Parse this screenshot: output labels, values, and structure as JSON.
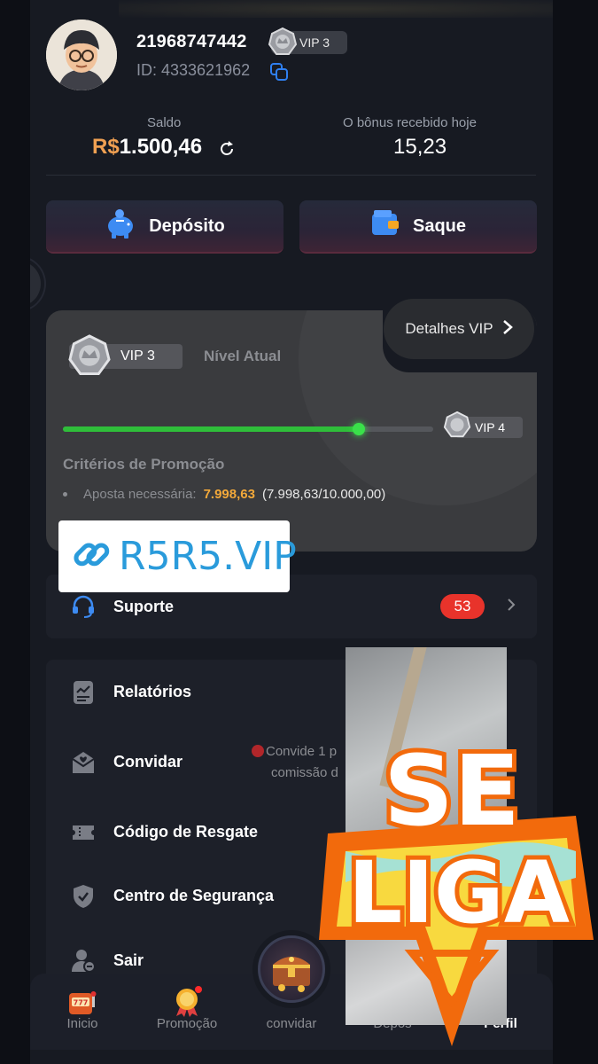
{
  "profile": {
    "username": "21968747442",
    "vip_chip": "VIP 3",
    "user_id": "ID: 4333621962"
  },
  "balance": {
    "saldo_label": "Saldo",
    "currency": "R$",
    "amount": "1.500,46",
    "bonus_label": "O bônus recebido hoje",
    "bonus_value": "15,23"
  },
  "actions": {
    "deposit_label": "Depósito",
    "withdraw_label": "Saque"
  },
  "vip": {
    "details_label": "Detalhes VIP",
    "current_level": "VIP 3",
    "current_label": "Nível Atual",
    "next_level": "VIP 4",
    "progress": 0.799863,
    "criteria_title": "Critérios de Promoção",
    "bet_label": "Aposta necessária",
    "bet_amount": "7.998,63",
    "bet_total": "(7.998,63/10.000,00)"
  },
  "watermark": {
    "text": "R5R5.VIP"
  },
  "menu": {
    "support_label": "Suporte",
    "support_badge": "53",
    "items": [
      {
        "label": "Relatórios",
        "icon": "report-icon"
      },
      {
        "label": "Convidar",
        "icon": "invite-icon"
      },
      {
        "label": "Código de Resgate",
        "icon": "ticket-icon"
      },
      {
        "label": "Centro de Segurança",
        "icon": "shield-icon"
      },
      {
        "label": "Sair",
        "icon": "logout-icon"
      }
    ],
    "invite_hint_line1": "Convide 1 p",
    "invite_hint_line2": "comissão d"
  },
  "bottom_nav": [
    {
      "label": "Inicio",
      "icon": "slot-machine-icon"
    },
    {
      "label": "Promoção",
      "icon": "medal-icon"
    },
    {
      "label": "convidar",
      "icon": "treasure-chest-icon"
    },
    {
      "label": "Depos",
      "icon": "deposit-icon"
    },
    {
      "label": "Perfil",
      "icon": "profile-icon"
    }
  ],
  "sticker": {
    "line1": "SE",
    "line2": "LIGA"
  },
  "colors": {
    "accent_orange": "#f0a052",
    "progress_green": "#2fbe3a",
    "badge_red": "#e8332b",
    "copy_blue": "#2f7ff0",
    "sticker_orange": "#f26a0c"
  }
}
